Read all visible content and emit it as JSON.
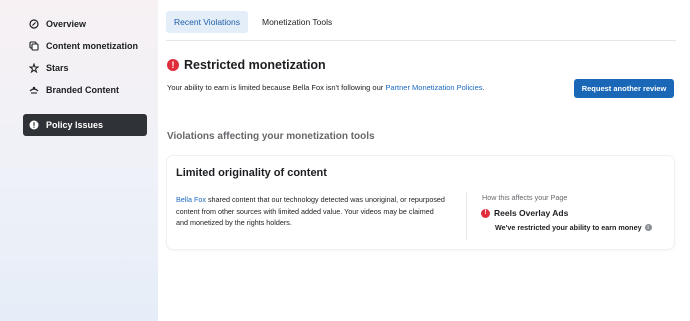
{
  "sidebar": {
    "items": [
      {
        "label": "Overview",
        "icon": "overview-icon"
      },
      {
        "label": "Content monetization",
        "icon": "content-monetization-icon"
      },
      {
        "label": "Stars",
        "icon": "stars-icon"
      },
      {
        "label": "Branded Content",
        "icon": "branded-content-icon"
      },
      {
        "label": "Policy Issues",
        "icon": "policy-issues-icon",
        "active": true
      }
    ]
  },
  "tabs": [
    {
      "label": "Recent Violations",
      "active": true
    },
    {
      "label": "Monetization Tools",
      "active": false
    }
  ],
  "restricted": {
    "title": "Restricted monetization",
    "desc_prefix": "Your ability to earn is limited because Bella Fox isn't following our ",
    "desc_link": "Partner Monetization Policies",
    "desc_suffix": ".",
    "button_label": "Request another review"
  },
  "violations": {
    "heading": "Violations affecting your monetization tools",
    "card": {
      "title": "Limited originality of content",
      "body_link": "Bella Fox",
      "body_text": " shared content that our technology detected was unoriginal, or repurposed content from other sources with limited added value. Your videos may be claimed and monetized by the rights holders.",
      "effect_label": "How this affects your Page",
      "effect_item": "Reels Overlay Ads",
      "effect_desc": "We've restricted your ability to earn money"
    }
  },
  "colors": {
    "accent": "#1a67b8",
    "error": "#e02d3c",
    "active_nav_bg": "#2f3236",
    "active_tab_bg": "#e4eef9"
  }
}
